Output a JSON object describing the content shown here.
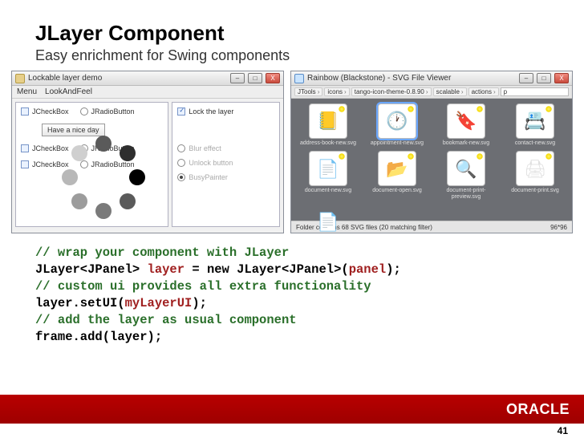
{
  "title": "JLayer Component",
  "subtitle": "Easy enrichment for Swing components",
  "leftWin": {
    "title": "Lockable layer demo",
    "menus": [
      "Menu",
      "LookAndFeel"
    ],
    "winBtns": {
      "min": "–",
      "max": "□",
      "close": "X"
    },
    "rows": [
      {
        "chk": "JCheckBox",
        "rad": "JRadioButton"
      },
      {
        "chk": "JCheckBox",
        "rad": "JRadioButton"
      },
      {
        "chk": "JCheckBox",
        "rad": "JRadioButton"
      }
    ],
    "button": "Have a nice day",
    "options": {
      "lock": "Lock the layer",
      "blur": "Blur effect",
      "unlock": "Unlock button",
      "busy": "BusyPainter"
    }
  },
  "rightWin": {
    "title": "Rainbow (Blackstone) - SVG File Viewer",
    "winBtns": {
      "min": "–",
      "max": "□",
      "close": "X"
    },
    "crumbs": [
      "JTools",
      "icons",
      "tango-icon-theme-0.8.90",
      "scalable",
      "actions"
    ],
    "filter": "p",
    "icons": [
      {
        "label": "address-book-new.svg",
        "glyph": "📒"
      },
      {
        "label": "appointment-new.svg",
        "glyph": "🕐",
        "sel": true
      },
      {
        "label": "bookmark-new.svg",
        "glyph": "🔖"
      },
      {
        "label": "contact-new.svg",
        "glyph": "📇"
      },
      {
        "label": "document-new.svg",
        "glyph": "📄"
      },
      {
        "label": "document-open.svg",
        "glyph": "📂"
      },
      {
        "label": "document-print-preview.svg",
        "glyph": "🔍"
      },
      {
        "label": "document-print.svg",
        "glyph": "🖨"
      }
    ],
    "extra": {
      "label": "",
      "glyph": "📄"
    },
    "status": "Folder contains 68 SVG files (20 matching filter)",
    "size": "96*96"
  },
  "code": {
    "l1": "// wrap your component with JLayer",
    "l2a": "JLayer<JPanel> ",
    "l2b": "layer",
    "l2c": " = new JLayer<JPanel>(",
    "l2d": "panel",
    "l2e": ");",
    "l3": "// custom ui provides all extra functionality",
    "l4a": "layer.setUI(",
    "l4b": "myLayerUI",
    "l4c": ");",
    "l5": "// add the layer as usual component",
    "l6": "frame.add(layer);"
  },
  "brand": "ORACLE",
  "page": "41",
  "spinnerColors": [
    "#5a5a5a",
    "#2e2e2e",
    "#000000",
    "#5a5a5a",
    "#7a7a7a",
    "#9c9c9c",
    "#b8b8b8",
    "#cfcfcf"
  ]
}
